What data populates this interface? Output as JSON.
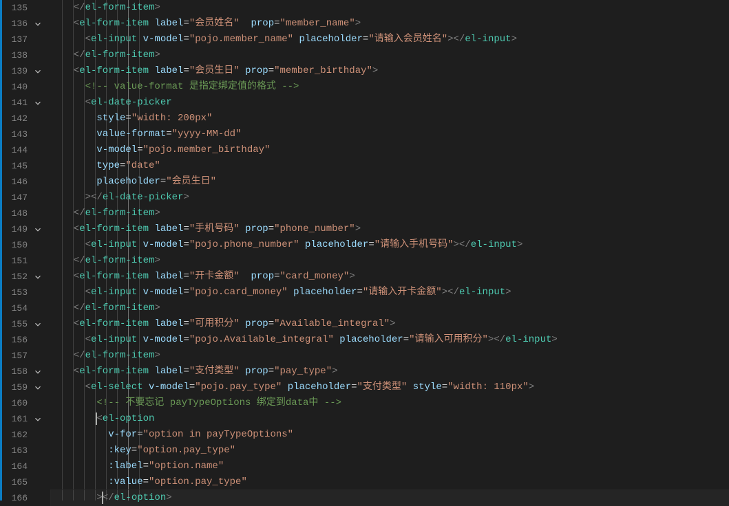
{
  "lineStart": 135,
  "lineCount": 32,
  "foldLines": [
    136,
    139,
    141,
    149,
    152,
    155,
    158,
    159,
    161
  ],
  "highlightLine": 166,
  "indentGuides": [
    0,
    16,
    32,
    48,
    64,
    80,
    96,
    112
  ],
  "activeGuide": 96,
  "baseIndentPx": 16,
  "charW": 8.4,
  "code": [
    {
      "indent": 9,
      "tokens": [
        [
          "punct",
          "</"
        ],
        [
          "name",
          "el-form-item"
        ],
        [
          "punct",
          ">"
        ]
      ]
    },
    {
      "indent": 9,
      "tokens": [
        [
          "punct",
          "<"
        ],
        [
          "name",
          "el-form-item"
        ],
        [
          "eq",
          " "
        ],
        [
          "attr",
          "label"
        ],
        [
          "eq",
          "="
        ],
        [
          "str",
          "\"会员姓名\""
        ],
        [
          "eq",
          "  "
        ],
        [
          "attr",
          "prop"
        ],
        [
          "eq",
          "="
        ],
        [
          "str",
          "\"member_name\""
        ],
        [
          "punct",
          ">"
        ]
      ]
    },
    {
      "indent": 10,
      "tokens": [
        [
          "punct",
          "<"
        ],
        [
          "name",
          "el-input"
        ],
        [
          "eq",
          " "
        ],
        [
          "attr",
          "v-model"
        ],
        [
          "eq",
          "="
        ],
        [
          "str",
          "\"pojo.member_name\""
        ],
        [
          "eq",
          " "
        ],
        [
          "attr",
          "placeholder"
        ],
        [
          "eq",
          "="
        ],
        [
          "str",
          "\"请输入会员姓名\""
        ],
        [
          "punct",
          "></"
        ],
        [
          "name",
          "el-input"
        ],
        [
          "punct",
          ">"
        ]
      ]
    },
    {
      "indent": 9,
      "tokens": [
        [
          "punct",
          "</"
        ],
        [
          "name",
          "el-form-item"
        ],
        [
          "punct",
          ">"
        ]
      ]
    },
    {
      "indent": 9,
      "tokens": [
        [
          "punct",
          "<"
        ],
        [
          "name",
          "el-form-item"
        ],
        [
          "eq",
          " "
        ],
        [
          "attr",
          "label"
        ],
        [
          "eq",
          "="
        ],
        [
          "str",
          "\"会员生日\""
        ],
        [
          "eq",
          " "
        ],
        [
          "attr",
          "prop"
        ],
        [
          "eq",
          "="
        ],
        [
          "str",
          "\"member_birthday\""
        ],
        [
          "punct",
          ">"
        ]
      ]
    },
    {
      "indent": 10,
      "tokens": [
        [
          "cmt",
          "<!-- value-format 是指定绑定值的格式 -->"
        ]
      ]
    },
    {
      "indent": 10,
      "tokens": [
        [
          "punct",
          "<"
        ],
        [
          "name",
          "el-date-picker"
        ]
      ]
    },
    {
      "indent": 11,
      "tokens": [
        [
          "attr",
          "style"
        ],
        [
          "eq",
          "="
        ],
        [
          "str",
          "\"width: 200px\""
        ]
      ]
    },
    {
      "indent": 11,
      "tokens": [
        [
          "attr",
          "value-format"
        ],
        [
          "eq",
          "="
        ],
        [
          "str",
          "\"yyyy-MM-dd\""
        ]
      ]
    },
    {
      "indent": 11,
      "tokens": [
        [
          "attr",
          "v-model"
        ],
        [
          "eq",
          "="
        ],
        [
          "str",
          "\"pojo.member_birthday\""
        ]
      ]
    },
    {
      "indent": 11,
      "tokens": [
        [
          "attr",
          "type"
        ],
        [
          "eq",
          "="
        ],
        [
          "str",
          "\"date\""
        ]
      ]
    },
    {
      "indent": 11,
      "tokens": [
        [
          "attr",
          "placeholder"
        ],
        [
          "eq",
          "="
        ],
        [
          "str",
          "\"会员生日\""
        ]
      ]
    },
    {
      "indent": 10,
      "tokens": [
        [
          "punct",
          "></"
        ],
        [
          "name",
          "el-date-picker"
        ],
        [
          "punct",
          ">"
        ]
      ]
    },
    {
      "indent": 9,
      "tokens": [
        [
          "punct",
          "</"
        ],
        [
          "name",
          "el-form-item"
        ],
        [
          "punct",
          ">"
        ]
      ]
    },
    {
      "indent": 9,
      "tokens": [
        [
          "punct",
          "<"
        ],
        [
          "name",
          "el-form-item"
        ],
        [
          "eq",
          " "
        ],
        [
          "attr",
          "label"
        ],
        [
          "eq",
          "="
        ],
        [
          "str",
          "\"手机号码\""
        ],
        [
          "eq",
          " "
        ],
        [
          "attr",
          "prop"
        ],
        [
          "eq",
          "="
        ],
        [
          "str",
          "\"phone_number\""
        ],
        [
          "punct",
          ">"
        ]
      ]
    },
    {
      "indent": 10,
      "tokens": [
        [
          "punct",
          "<"
        ],
        [
          "name",
          "el-input"
        ],
        [
          "eq",
          " "
        ],
        [
          "attr",
          "v-model"
        ],
        [
          "eq",
          "="
        ],
        [
          "str",
          "\"pojo.phone_number\""
        ],
        [
          "eq",
          " "
        ],
        [
          "attr",
          "placeholder"
        ],
        [
          "eq",
          "="
        ],
        [
          "str",
          "\"请输入手机号码\""
        ],
        [
          "punct",
          "></"
        ],
        [
          "name",
          "el-input"
        ],
        [
          "punct",
          ">"
        ]
      ]
    },
    {
      "indent": 9,
      "tokens": [
        [
          "punct",
          "</"
        ],
        [
          "name",
          "el-form-item"
        ],
        [
          "punct",
          ">"
        ]
      ]
    },
    {
      "indent": 9,
      "tokens": [
        [
          "punct",
          "<"
        ],
        [
          "name",
          "el-form-item"
        ],
        [
          "eq",
          " "
        ],
        [
          "attr",
          "label"
        ],
        [
          "eq",
          "="
        ],
        [
          "str",
          "\"开卡金额\""
        ],
        [
          "eq",
          "  "
        ],
        [
          "attr",
          "prop"
        ],
        [
          "eq",
          "="
        ],
        [
          "str",
          "\"card_money\""
        ],
        [
          "punct",
          ">"
        ]
      ]
    },
    {
      "indent": 10,
      "tokens": [
        [
          "punct",
          "<"
        ],
        [
          "name",
          "el-input"
        ],
        [
          "eq",
          " "
        ],
        [
          "attr",
          "v-model"
        ],
        [
          "eq",
          "="
        ],
        [
          "str",
          "\"pojo.card_money\""
        ],
        [
          "eq",
          " "
        ],
        [
          "attr",
          "placeholder"
        ],
        [
          "eq",
          "="
        ],
        [
          "str",
          "\"请输入开卡金额\""
        ],
        [
          "punct",
          "></"
        ],
        [
          "name",
          "el-input"
        ],
        [
          "punct",
          ">"
        ]
      ]
    },
    {
      "indent": 9,
      "tokens": [
        [
          "punct",
          "</"
        ],
        [
          "name",
          "el-form-item"
        ],
        [
          "punct",
          ">"
        ]
      ]
    },
    {
      "indent": 9,
      "tokens": [
        [
          "punct",
          "<"
        ],
        [
          "name",
          "el-form-item"
        ],
        [
          "eq",
          " "
        ],
        [
          "attr",
          "label"
        ],
        [
          "eq",
          "="
        ],
        [
          "str",
          "\"可用积分\""
        ],
        [
          "eq",
          " "
        ],
        [
          "attr",
          "prop"
        ],
        [
          "eq",
          "="
        ],
        [
          "str",
          "\"Available_integral\""
        ],
        [
          "punct",
          ">"
        ]
      ]
    },
    {
      "indent": 10,
      "tokens": [
        [
          "punct",
          "<"
        ],
        [
          "name",
          "el-input"
        ],
        [
          "eq",
          " "
        ],
        [
          "attr",
          "v-model"
        ],
        [
          "eq",
          "="
        ],
        [
          "str",
          "\"pojo.Available_integral\""
        ],
        [
          "eq",
          " "
        ],
        [
          "attr",
          "placeholder"
        ],
        [
          "eq",
          "="
        ],
        [
          "str",
          "\"请输入可用积分\""
        ],
        [
          "punct",
          "></"
        ],
        [
          "name",
          "el-input"
        ],
        [
          "punct",
          ">"
        ]
      ]
    },
    {
      "indent": 9,
      "tokens": [
        [
          "punct",
          "</"
        ],
        [
          "name",
          "el-form-item"
        ],
        [
          "punct",
          ">"
        ]
      ]
    },
    {
      "indent": 9,
      "tokens": [
        [
          "punct",
          "<"
        ],
        [
          "name",
          "el-form-item"
        ],
        [
          "eq",
          " "
        ],
        [
          "attr",
          "label"
        ],
        [
          "eq",
          "="
        ],
        [
          "str",
          "\"支付类型\""
        ],
        [
          "eq",
          " "
        ],
        [
          "attr",
          "prop"
        ],
        [
          "eq",
          "="
        ],
        [
          "str",
          "\"pay_type\""
        ],
        [
          "punct",
          ">"
        ]
      ]
    },
    {
      "indent": 10,
      "tokens": [
        [
          "punct",
          "<"
        ],
        [
          "name",
          "el-select"
        ],
        [
          "eq",
          " "
        ],
        [
          "attr",
          "v-model"
        ],
        [
          "eq",
          "="
        ],
        [
          "str",
          "\"pojo.pay_type\""
        ],
        [
          "eq",
          " "
        ],
        [
          "attr",
          "placeholder"
        ],
        [
          "eq",
          "="
        ],
        [
          "str",
          "\"支付类型\""
        ],
        [
          "eq",
          " "
        ],
        [
          "attr",
          "style"
        ],
        [
          "eq",
          "="
        ],
        [
          "str",
          "\"width: 110px\""
        ],
        [
          "punct",
          ">"
        ]
      ]
    },
    {
      "indent": 11,
      "tokens": [
        [
          "cmt",
          "<!-- 不要忘记 payTypeOptions 绑定到data中 -->"
        ]
      ]
    },
    {
      "indent": 11,
      "tokens": [
        [
          "punct",
          "<"
        ],
        [
          "name",
          "el-option"
        ]
      ]
    },
    {
      "indent": 12,
      "tokens": [
        [
          "attr",
          "v-for"
        ],
        [
          "eq",
          "="
        ],
        [
          "str",
          "\"option in payTypeOptions\""
        ]
      ]
    },
    {
      "indent": 12,
      "tokens": [
        [
          "attr",
          ":key"
        ],
        [
          "eq",
          "="
        ],
        [
          "str",
          "\"option.pay_type\""
        ]
      ]
    },
    {
      "indent": 12,
      "tokens": [
        [
          "attr",
          ":label"
        ],
        [
          "eq",
          "="
        ],
        [
          "str",
          "\"option.name\""
        ]
      ]
    },
    {
      "indent": 12,
      "tokens": [
        [
          "attr",
          ":value"
        ],
        [
          "eq",
          "="
        ],
        [
          "str",
          "\"option.pay_type\""
        ]
      ]
    },
    {
      "indent": 11,
      "tokens": [
        [
          "punct",
          "></"
        ],
        [
          "name",
          "el-option"
        ],
        [
          "punct",
          ">"
        ]
      ]
    }
  ]
}
